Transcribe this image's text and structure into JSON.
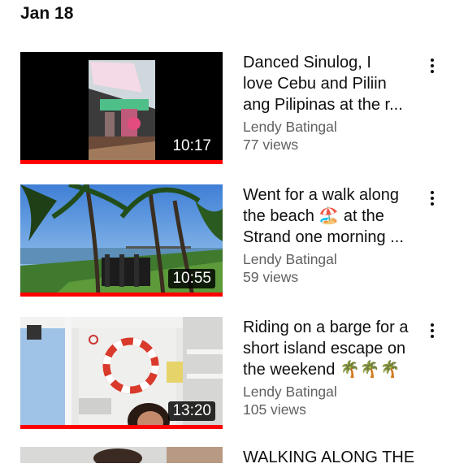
{
  "section": {
    "date": "Jan 18"
  },
  "videos": [
    {
      "title_lines": [
        "Danced Sinulog, I",
        "love Cebu and Piliin",
        "ang Pilipinas at the r..."
      ],
      "channel": "Lendy Batingal",
      "views": "77 views",
      "duration": "10:17",
      "watched_fraction": 1.0
    },
    {
      "title_lines": [
        "Went for a walk along",
        "the beach 🏖️ at the",
        "Strand one morning ..."
      ],
      "channel": "Lendy Batingal",
      "views": "59 views",
      "duration": "10:55",
      "watched_fraction": 1.0
    },
    {
      "title_lines": [
        "Riding on a barge for a",
        "short island escape on",
        "the weekend 🌴🌴🌴"
      ],
      "channel": "Lendy Batingal",
      "views": "105 views",
      "duration": "13:20",
      "watched_fraction": 1.0
    }
  ],
  "partial_video": {
    "title": "WALKING ALONG THE"
  },
  "colors": {
    "watched_bar": "#ff0000",
    "secondary_text": "#606060",
    "primary_text": "#0f0f0f"
  },
  "icons": {
    "more": "three-dots-vertical"
  }
}
